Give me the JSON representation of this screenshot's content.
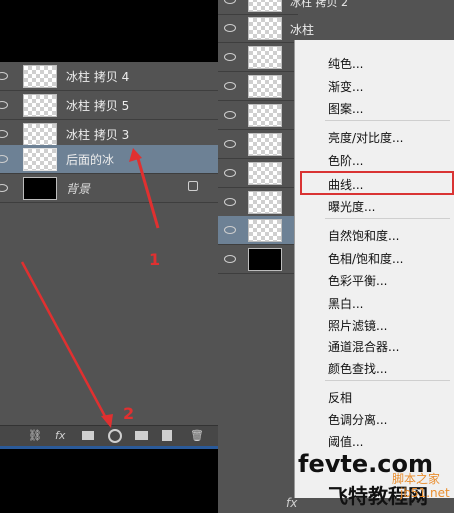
{
  "left_panel": {
    "layers": [
      {
        "name": "冰柱 拷贝 4"
      },
      {
        "name": "冰柱 拷贝 5"
      },
      {
        "name": "冰柱 拷贝 3"
      },
      {
        "name": "后面的冰"
      },
      {
        "name": "背景"
      }
    ],
    "footer_icons": [
      "link-icon",
      "fx-icon",
      "mask-icon",
      "adjustment-icon",
      "folder-icon",
      "new-layer-icon",
      "trash-icon"
    ],
    "fx_label": "fx"
  },
  "right_panel": {
    "top_layer_name": "冰柱 拷贝 2",
    "second_layer_name": "冰柱",
    "fx_label": "fx"
  },
  "menu": {
    "group1": [
      "纯色...",
      "渐变...",
      "图案..."
    ],
    "group2": [
      "亮度/对比度...",
      "色阶...",
      "曲线...",
      "曝光度..."
    ],
    "group3": [
      "自然饱和度...",
      "色相/饱和度...",
      "色彩平衡...",
      "黑白...",
      "照片滤镜...",
      "通道混合器...",
      "颜色查找..."
    ],
    "group4": [
      "反相",
      "色调分离...",
      "阈值..."
    ]
  },
  "annotations": {
    "label_1": "1",
    "label_2": "2"
  },
  "watermark": {
    "line1": "fevte.com",
    "line2": "脚本之家",
    "line3": "飞特教程网",
    "line4": "jb51.net"
  }
}
